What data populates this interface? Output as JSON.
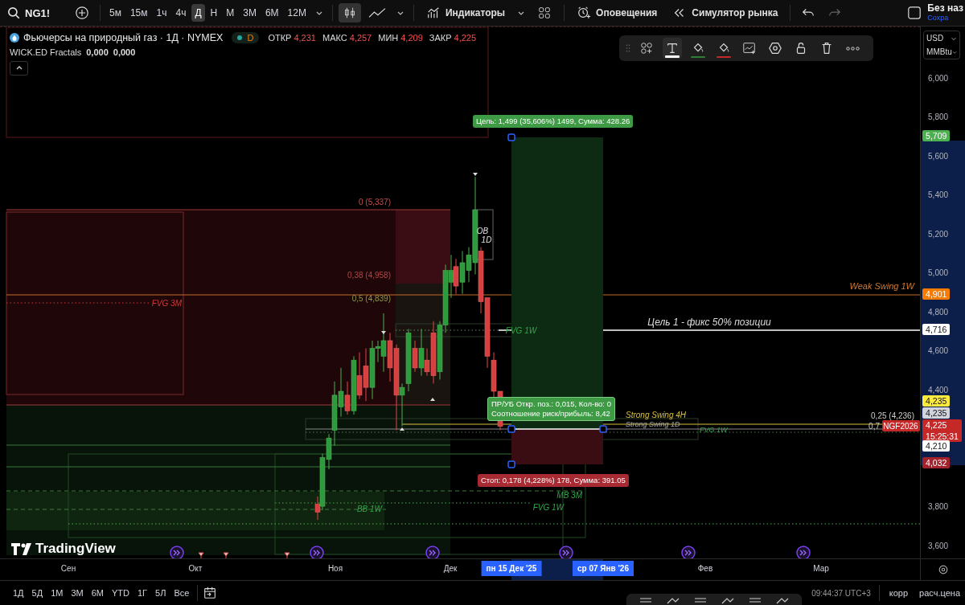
{
  "toolbar": {
    "symbol": "NG1!",
    "intervals": [
      {
        "label": "5м",
        "selected": false
      },
      {
        "label": "15м",
        "selected": false
      },
      {
        "label": "1ч",
        "selected": false
      },
      {
        "label": "4ч",
        "selected": false
      },
      {
        "label": "Д",
        "selected": true
      },
      {
        "label": "Н",
        "selected": false
      },
      {
        "label": "М",
        "selected": false
      },
      {
        "label": "3М",
        "selected": false
      },
      {
        "label": "6М",
        "selected": false
      },
      {
        "label": "12М",
        "selected": false
      }
    ],
    "chart_styles": [
      {
        "kind": "candles",
        "selected": true
      },
      {
        "kind": "line",
        "selected": false
      }
    ],
    "indicators": "Индикаторы",
    "alerts": "Оповещения",
    "replay": "Симулятор рынка",
    "layout_name": "Без наз",
    "save": "Сохра"
  },
  "legend": {
    "title": "Фьючерсы на природный газ · 1Д · NYMEX",
    "badge": "D",
    "fields": [
      {
        "label": "ОТКР",
        "value": "4,231"
      },
      {
        "label": "МАКС",
        "value": "4,257"
      },
      {
        "label": "МИН",
        "value": "4,209"
      },
      {
        "label": "ЗАКР",
        "value": "4,225"
      }
    ],
    "indicator": "WICK.ED Fractals",
    "indicator_values": [
      "0,000",
      "0,000"
    ]
  },
  "drawing_toolbar": {
    "tools": [
      {
        "kind": "add",
        "selected": false
      },
      {
        "kind": "text",
        "selected": true
      },
      {
        "kind": "fill",
        "color": "#2e7d32",
        "selected": false
      },
      {
        "kind": "fill",
        "color": "#c62828",
        "selected": false
      },
      {
        "kind": "template",
        "selected": false
      },
      {
        "kind": "settings",
        "selected": false
      },
      {
        "kind": "lock",
        "selected": false
      },
      {
        "kind": "trash",
        "selected": false
      },
      {
        "kind": "more",
        "selected": false
      }
    ]
  },
  "chart": {
    "labels": [
      "0 (5,337)",
      "0,38 (4,958)",
      "0,5 (4,839)",
      "FVG 3M",
      "OB",
      "1D",
      "FVG 1W",
      "Цель 1 - фикс 50% позиции",
      "Weak Swing 1W",
      "Strong Swing 4H",
      "Strong Swing 1D",
      "FVG 1W",
      "0,25 (4,236)",
      "0,7",
      "MB 3M",
      "FVG 1W",
      "BB 1W"
    ],
    "symbol_tag": "NGF2026",
    "logo": "TradingView",
    "position": {
      "target": "Цель: 1,499 (35,606%) 1499, Сумма: 428.26",
      "info": [
        "ПР/УБ Откр. поз.: 0,015, Кол-во: 0",
        "Соотношение риск/прибыль: 8,42"
      ],
      "stop": "Стоп: 0,178 (4,228%) 178, Сумма: 391.05"
    }
  },
  "price_axis": {
    "currency": "USD",
    "unit": "MMBtu",
    "ticks": [
      "6,000",
      "5,800",
      "5,600",
      "5,400",
      "5,200",
      "5,000",
      "4,800",
      "4,600",
      "4,400",
      "3,800",
      "3,600"
    ],
    "labels": [
      {
        "text": "5,709",
        "color": "#4caf50"
      },
      {
        "text": "4,901",
        "color": "#f57c00"
      },
      {
        "text": "4,716",
        "color": "#ffffff"
      },
      {
        "text": "4,235",
        "color": "#ffeb3b"
      },
      {
        "text": "4,235",
        "color": "#d1d4dc"
      },
      {
        "text": "4,225",
        "color": "#c62828",
        "countdown": "15:25:31"
      },
      {
        "text": "4,210",
        "color": "#ffffff"
      },
      {
        "text": "4,032",
        "color": "#a3222c"
      }
    ]
  },
  "time_axis": {
    "labels": [
      "Сен",
      "Окт",
      "Ноя",
      "Дек",
      "Фев",
      "Мар"
    ],
    "markers": [
      "пн 15 Дек '25",
      "ср 07 Янв '26"
    ]
  },
  "bottom_bar": {
    "ranges": [
      "1Д",
      "5Д",
      "1М",
      "3М",
      "6М",
      "YTD",
      "1Г",
      "5Л",
      "Все"
    ],
    "time": "09:44:37 UTC+3",
    "adjust": "корр",
    "settlement": "расч.цена"
  }
}
